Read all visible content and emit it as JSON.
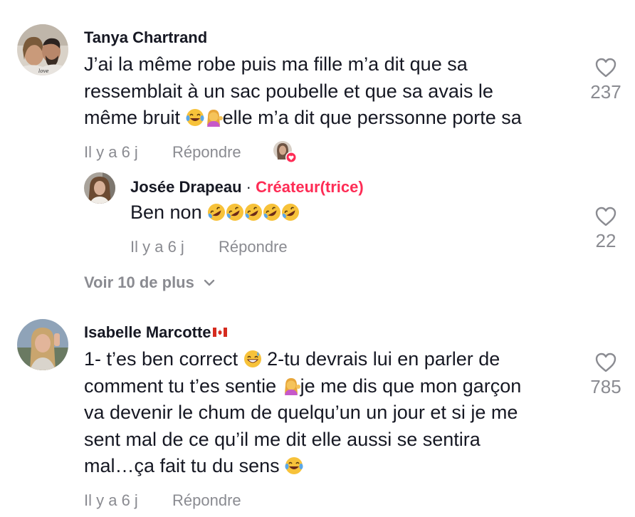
{
  "comments": [
    {
      "author": "Tanya Chartrand",
      "lines": [
        "J’ai la même robe puis ma fille m’a dit que sa",
        "ressemblait à un sac poubelle et que sa avais le",
        "même bruit",
        "elle m’a dit que perssonne porte sa"
      ],
      "time": "Il y a 6 j",
      "reply_label": "Répondre",
      "likes": "237",
      "emojis": [
        "tears-of-joy",
        "woman-tipping-hand"
      ],
      "replies": [
        {
          "author": "Josée Drapeau",
          "separator": "·",
          "badge": "Créateur(trice)",
          "text": "Ben non",
          "emojis": [
            "rofl",
            "rofl",
            "rofl",
            "rofl",
            "rofl"
          ],
          "time": "Il y a 6 j",
          "reply_label": "Répondre",
          "likes": "22"
        }
      ],
      "more_label": "Voir 10 de plus"
    },
    {
      "author": "Isabelle Marcotte",
      "flag": "canada-flag",
      "lines": [
        "1- t’es ben correct",
        "2-tu devrais lui en parler de",
        "comment tu t’es sentie",
        "je me dis que mon garçon",
        "va devenir le chum de quelqu’un un jour et si je me",
        "sent mal de ce qu’il me dit elle aussi se sentira",
        "mal…ça fait tu du sens"
      ],
      "time": "Il y a 6 j",
      "reply_label": "Répondre",
      "likes": "785",
      "emojis": [
        "grinning-sweat",
        "woman-tipping-hand",
        "tears-of-joy"
      ]
    }
  ],
  "colors": {
    "text": "#161823",
    "muted": "#8a8b91",
    "creator": "#fe2c55"
  },
  "icons": [
    "heart-outline-icon",
    "chevron-down-icon"
  ]
}
